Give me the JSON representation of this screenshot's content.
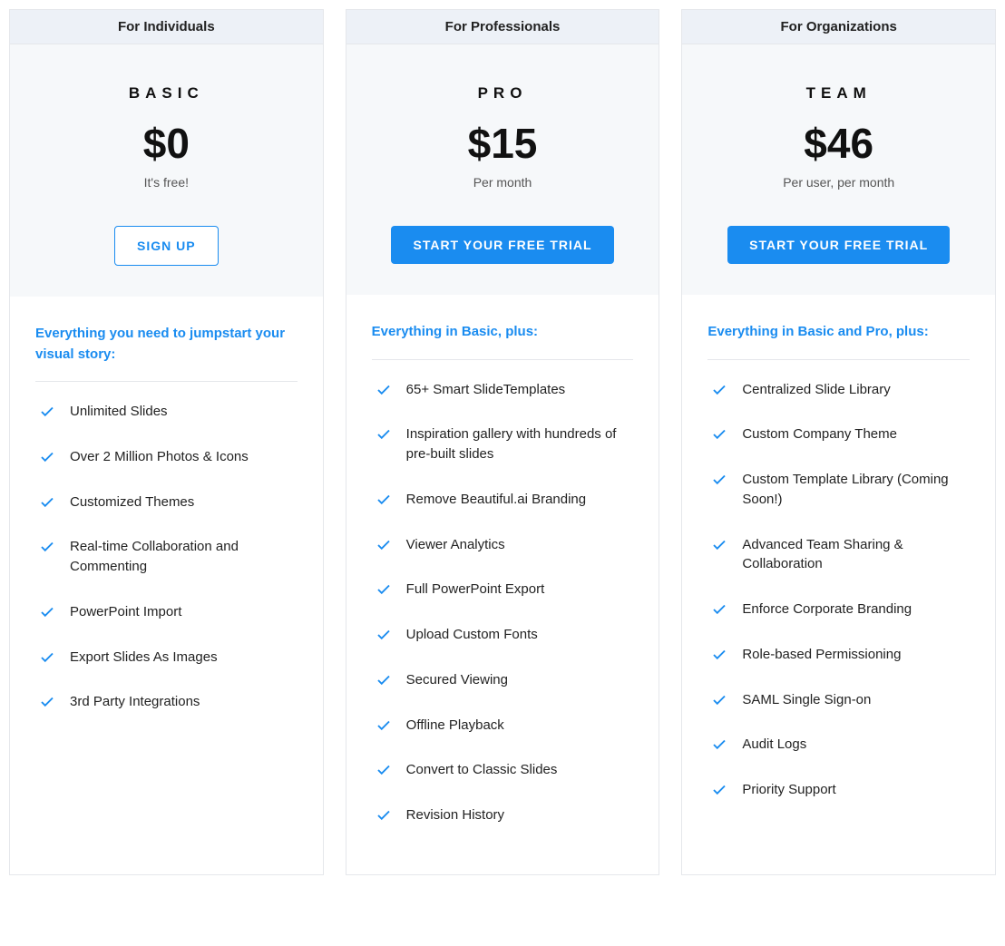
{
  "plans": [
    {
      "audience": "For Individuals",
      "name": "BASIC",
      "price": "$0",
      "sub": "It's free!",
      "cta": "SIGN UP",
      "cta_style": "outline",
      "intro": "Everything you need to jumpstart your visual story:",
      "features": [
        "Unlimited Slides",
        "Over 2 Million Photos & Icons",
        "Customized Themes",
        "Real-time Collaboration and Commenting",
        "PowerPoint Import",
        "Export Slides As Images",
        "3rd Party Integrations"
      ]
    },
    {
      "audience": "For Professionals",
      "name": "PRO",
      "price": "$15",
      "sub": "Per month",
      "cta": "START YOUR FREE TRIAL",
      "cta_style": "solid",
      "intro": "Everything in Basic, plus:",
      "features": [
        "65+ Smart SlideTemplates",
        "Inspiration gallery with hundreds of pre-built slides",
        "Remove Beautiful.ai Branding",
        "Viewer Analytics",
        "Full PowerPoint Export",
        "Upload Custom Fonts",
        "Secured Viewing",
        "Offline Playback",
        "Convert to Classic Slides",
        "Revision History"
      ]
    },
    {
      "audience": "For Organizations",
      "name": "TEAM",
      "price": "$46",
      "sub": "Per user, per month",
      "cta": "START YOUR FREE TRIAL",
      "cta_style": "solid",
      "intro": "Everything in Basic and Pro, plus:",
      "features": [
        "Centralized Slide Library",
        "Custom Company Theme",
        "Custom Template Library (Coming Soon!)",
        "Advanced Team Sharing & Collaboration",
        "Enforce Corporate Branding",
        "Role-based Permissioning",
        "SAML Single Sign-on",
        "Audit Logs",
        "Priority Support"
      ]
    }
  ]
}
